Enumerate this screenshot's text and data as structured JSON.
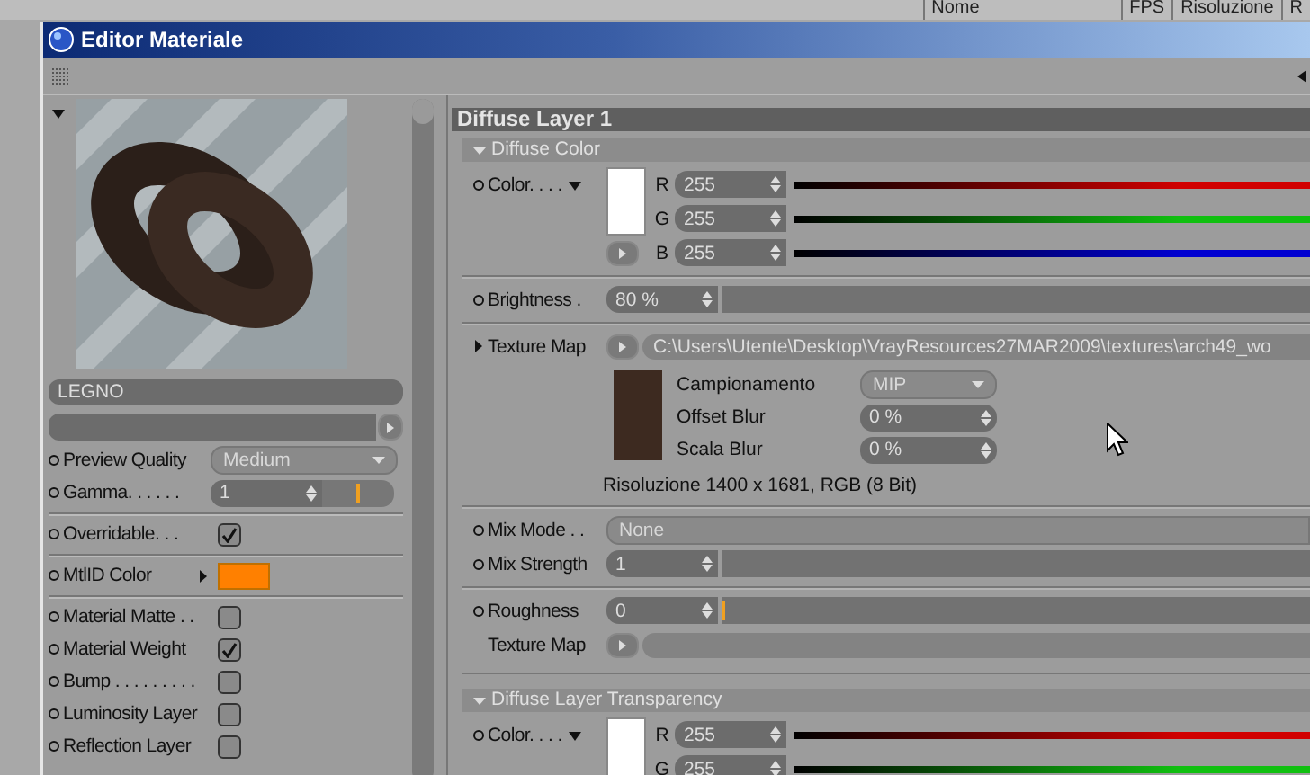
{
  "background_table": {
    "columns": [
      "Nome",
      "FPS",
      "Risoluzione",
      "R"
    ]
  },
  "window": {
    "title": "Editor Materiale"
  },
  "left": {
    "name": "LEGNO",
    "groups": [
      [
        {
          "kind": "dropdown",
          "label": "Preview Quality",
          "value": "Medium"
        },
        {
          "kind": "slider",
          "label": "Gamma. . . . . .",
          "value": "1",
          "level": 0.5
        }
      ],
      [
        {
          "kind": "checkbox",
          "label": "Overridable. . .",
          "checked": true
        }
      ],
      [
        {
          "kind": "color",
          "label": "MtlID Color",
          "color": "#ff8000"
        }
      ],
      [
        {
          "kind": "checkbox",
          "label": "Material Matte . .",
          "checked": false
        },
        {
          "kind": "checkbox",
          "label": "Material Weight",
          "checked": true
        },
        {
          "kind": "checkbox",
          "label": "Bump . . . . . . . . .",
          "checked": false
        },
        {
          "kind": "checkbox",
          "label": "Luminosity Layer",
          "checked": false
        },
        {
          "kind": "checkbox",
          "label": "Reflection Layer",
          "checked": false
        }
      ]
    ]
  },
  "panel": {
    "title": "Diffuse Layer 1",
    "groups": [
      {
        "title": "Diffuse Color",
        "rows": [
          {
            "kind": "color",
            "bullet": true,
            "label": "Color. . . .",
            "color": "#ffffff",
            "channels": [
              {
                "name": "R",
                "value": "255",
                "color": "#d00000"
              },
              {
                "name": "G",
                "value": "255",
                "color": "#10c010"
              },
              {
                "name": "B",
                "value": "255",
                "color": "#0000d0"
              }
            ]
          },
          {
            "kind": "slider",
            "bullet": true,
            "label": "Brightness  .",
            "value": "80 %",
            "rule_before": true
          },
          {
            "kind": "texture",
            "expandable": true,
            "label": "Texture Map",
            "path": "C:\\Users\\Utente\\Desktop\\VrayResources27MAR2009\\textures\\arch49_wo",
            "rule_before": true
          },
          {
            "kind": "texture_info",
            "params": [
              {
                "kind": "dropdown",
                "label": "Campionamento",
                "value": "MIP"
              },
              {
                "kind": "number",
                "label": "Offset Blur",
                "value": "0 %"
              },
              {
                "kind": "number",
                "label": "Scala Blur",
                "value": "0 %"
              }
            ],
            "resolution": "Risoluzione 1400 x 1681, RGB (8 Bit)"
          },
          {
            "kind": "dropdown",
            "bullet": true,
            "label": "Mix Mode . .",
            "value": "None",
            "rule_before": true
          },
          {
            "kind": "slider",
            "bullet": true,
            "label": "Mix Strength",
            "value": "1"
          },
          {
            "kind": "slider",
            "bullet": true,
            "label": "Roughness",
            "value": "0",
            "level": 0,
            "rule_before": true
          },
          {
            "kind": "texture",
            "label": "Texture Map"
          }
        ]
      },
      {
        "title": "Diffuse Layer Transparency",
        "rows": [
          {
            "kind": "color",
            "bullet": true,
            "label": "Color. . . .",
            "color": "#ffffff",
            "channels": [
              {
                "name": "R",
                "value": "255",
                "color": "#d00000"
              },
              {
                "name": "G",
                "value": "255",
                "color": "#10c010"
              }
            ]
          }
        ]
      }
    ]
  }
}
